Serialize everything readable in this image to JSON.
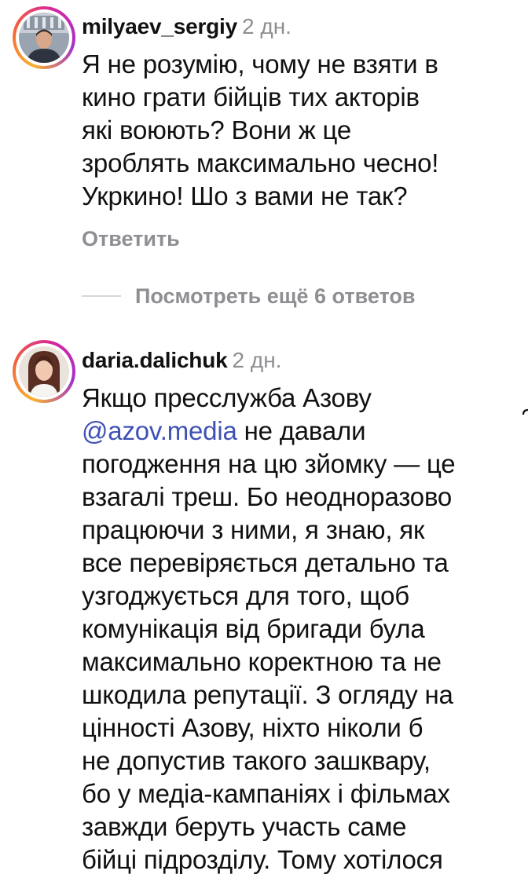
{
  "comments": [
    {
      "username": "milyaev_sergiy",
      "time": "2 дн.",
      "lines": [
        "Я не розумію, чому не взяти в",
        "кино грати бійців тих акторів",
        "які воюють? Вони ж це",
        "зроблять максимально чесно!",
        "Укркино! Шо з вами не так?"
      ],
      "reply_label": "Ответить",
      "view_replies_label": "Посмотреть ещё 6 ответов"
    },
    {
      "username": "daria.dalichuk",
      "time": "2 дн.",
      "line1": "Якщо пресслужба Азову",
      "mention": "@azov.media",
      "line2_rest": " не давали",
      "lines": [
        "погодження на цю зйомку — це",
        "взагалі треш. Бо неодноразово",
        "працюючи з ними, я знаю, як",
        "все перевіряється детально та",
        "узгоджується для того, щоб",
        "комунікація від бригади була",
        "максимально коректною та не",
        "шкодила репутації. З огляду на",
        "цінності Азову, ніхто ніколи б",
        "не допустив такого зашквару,",
        "бо у медіа-кампаніях і фільмах",
        "завжди беруть участь саме",
        "бійці підрозділу. Тому хотілося"
      ]
    }
  ],
  "colors": {
    "text": "#111111",
    "muted": "#8e8e93",
    "mention": "#3f51b5"
  }
}
